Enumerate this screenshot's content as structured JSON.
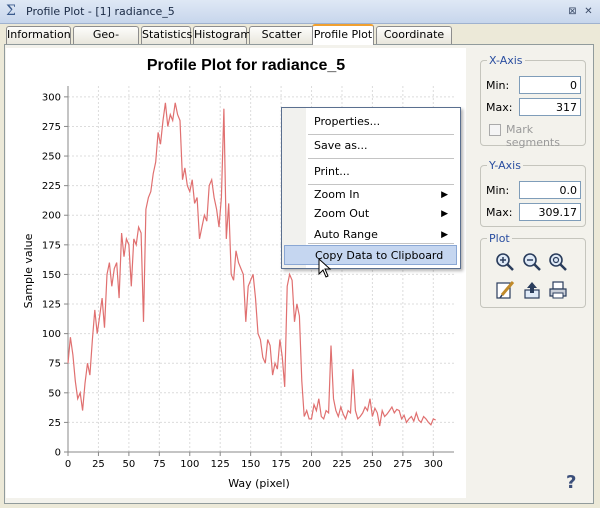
{
  "window": {
    "title": "Profile Plot - [1] radiance_5",
    "controls": [
      "⊠",
      "✕"
    ]
  },
  "tabs": [
    "Information",
    "Geo-Coding",
    "Statistics",
    "Histogram",
    "Scatter Plot",
    "Profile Plot",
    "Coordinate List"
  ],
  "active_tab": "Profile Plot",
  "context_menu": {
    "items": [
      {
        "label": "Properties..."
      },
      {
        "label": "Save as..."
      },
      {
        "label": "Print..."
      },
      {
        "label": "Zoom In",
        "submenu": true
      },
      {
        "label": "Zoom Out",
        "submenu": true
      },
      {
        "label": "Auto Range",
        "submenu": true
      },
      {
        "label": "Copy Data to Clipboard",
        "highlighted": true
      }
    ]
  },
  "x_axis": {
    "title": "X-Axis",
    "min_label": "Min:",
    "min_value": "0",
    "max_label": "Max:",
    "max_value": "317",
    "mark_segments_label": "Mark segments",
    "mark_segments_checked": false
  },
  "y_axis": {
    "title": "Y-Axis",
    "min_label": "Min:",
    "min_value": "0.0",
    "max_label": "Max:",
    "max_value": "309.17"
  },
  "plot_group": {
    "title": "Plot",
    "icons": [
      "zoom-in-icon",
      "zoom-out-icon",
      "zoom-all-icon",
      "edit-icon",
      "export-icon",
      "print-icon"
    ]
  },
  "help_label": "?",
  "chart_data": {
    "type": "line",
    "title": "Profile Plot for radiance_5",
    "xlabel": "Way (pixel)",
    "ylabel": "Sample value",
    "xlim": [
      0,
      317
    ],
    "ylim": [
      0,
      309.17
    ],
    "xticks": [
      0,
      25,
      50,
      75,
      100,
      125,
      150,
      175,
      200,
      225,
      250,
      275,
      300
    ],
    "yticks": [
      0,
      25,
      50,
      75,
      100,
      125,
      150,
      175,
      200,
      225,
      250,
      275,
      300
    ],
    "grid": true,
    "line_color": "#e07070",
    "x": [
      0,
      2,
      4,
      6,
      8,
      10,
      12,
      14,
      16,
      18,
      20,
      22,
      24,
      26,
      28,
      30,
      32,
      34,
      36,
      38,
      40,
      42,
      44,
      46,
      48,
      50,
      52,
      54,
      56,
      58,
      60,
      62,
      64,
      66,
      68,
      70,
      72,
      74,
      76,
      78,
      80,
      82,
      84,
      86,
      88,
      90,
      92,
      94,
      96,
      98,
      100,
      102,
      104,
      106,
      108,
      110,
      112,
      114,
      116,
      118,
      120,
      122,
      124,
      126,
      128,
      130,
      132,
      134,
      136,
      138,
      140,
      142,
      144,
      146,
      148,
      150,
      152,
      154,
      156,
      158,
      160,
      162,
      164,
      166,
      168,
      170,
      172,
      174,
      176,
      178,
      180,
      182,
      184,
      186,
      188,
      190,
      192,
      194,
      196,
      198,
      200,
      202,
      204,
      206,
      208,
      210,
      212,
      214,
      216,
      218,
      220,
      222,
      224,
      226,
      228,
      230,
      232,
      234,
      236,
      238,
      240,
      242,
      244,
      246,
      248,
      250,
      252,
      254,
      256,
      258,
      260,
      262,
      264,
      266,
      268,
      270,
      272,
      274,
      276,
      278,
      280,
      282,
      284,
      286,
      288,
      290,
      292,
      294,
      296,
      298,
      300,
      302
    ],
    "values": [
      75,
      97,
      82,
      60,
      45,
      50,
      35,
      58,
      75,
      65,
      95,
      120,
      100,
      115,
      130,
      105,
      150,
      160,
      140,
      155,
      160,
      130,
      185,
      165,
      180,
      175,
      140,
      180,
      175,
      190,
      185,
      110,
      205,
      215,
      220,
      235,
      245,
      270,
      260,
      280,
      295,
      275,
      285,
      280,
      295,
      285,
      280,
      230,
      240,
      225,
      220,
      230,
      210,
      215,
      180,
      190,
      200,
      195,
      225,
      230,
      215,
      205,
      190,
      215,
      290,
      180,
      210,
      150,
      145,
      170,
      160,
      155,
      150,
      110,
      140,
      145,
      150,
      130,
      100,
      95,
      80,
      75,
      95,
      90,
      65,
      75,
      70,
      95,
      80,
      55,
      140,
      150,
      145,
      110,
      125,
      115,
      60,
      30,
      35,
      28,
      28,
      40,
      35,
      45,
      30,
      28,
      35,
      33,
      90,
      45,
      35,
      30,
      38,
      32,
      28,
      35,
      33,
      70,
      35,
      28,
      30,
      33,
      38,
      35,
      45,
      30,
      37,
      33,
      22,
      35,
      30,
      32,
      35,
      38,
      33,
      36,
      35,
      28,
      31,
      25,
      28,
      30,
      26,
      33,
      27,
      25,
      30,
      28,
      25,
      23,
      28,
      27
    ]
  }
}
